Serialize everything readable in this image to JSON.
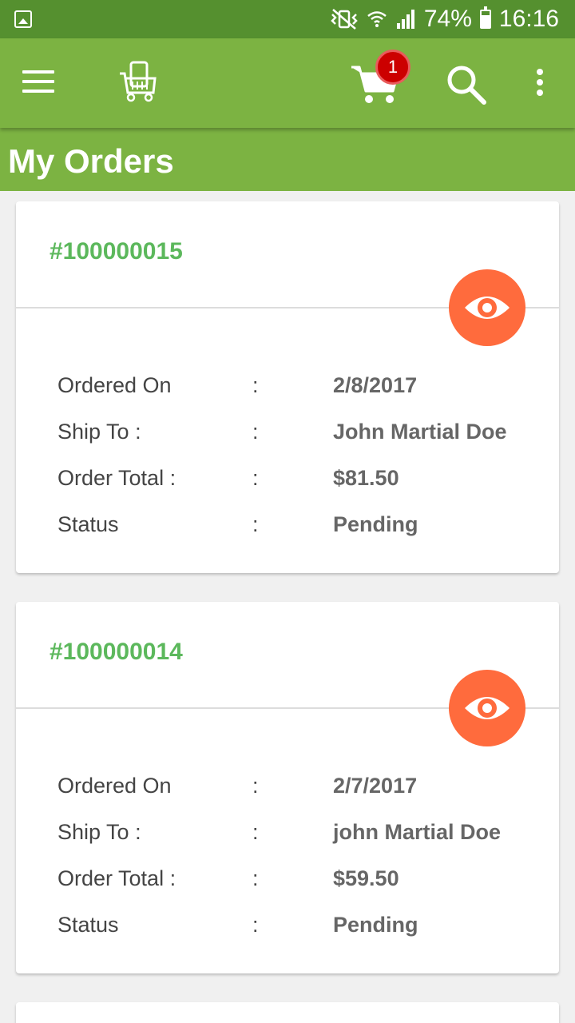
{
  "status_bar": {
    "battery": "74%",
    "time": "16:16"
  },
  "toolbar": {
    "cart_count": "1"
  },
  "page": {
    "title": "My Orders"
  },
  "orders": [
    {
      "number": "#100000015",
      "rows": [
        {
          "label": "Ordered On",
          "sep": ":",
          "value": "2/8/2017"
        },
        {
          "label": "Ship To :",
          "sep": ":",
          "value": "John Martial Doe"
        },
        {
          "label": "Order Total :",
          "sep": ":",
          "value": "$81.50"
        },
        {
          "label": "Status",
          "sep": ":",
          "value": "Pending"
        }
      ]
    },
    {
      "number": "#100000014",
      "rows": [
        {
          "label": "Ordered On",
          "sep": ":",
          "value": "2/7/2017"
        },
        {
          "label": "Ship To :",
          "sep": ":",
          "value": "john Martial Doe"
        },
        {
          "label": "Order Total :",
          "sep": ":",
          "value": "$59.50"
        },
        {
          "label": "Status",
          "sep": ":",
          "value": "Pending"
        }
      ]
    }
  ],
  "colors": {
    "status_bar": "#55902f",
    "toolbar": "#7cb342",
    "order_number": "#5cb85c",
    "view_button": "#ff6b3d",
    "badge": "#cc0000"
  },
  "icons": [
    "menu-icon",
    "shop-logo-icon",
    "cart-icon",
    "search-icon",
    "more-vert-icon",
    "eye-icon"
  ]
}
